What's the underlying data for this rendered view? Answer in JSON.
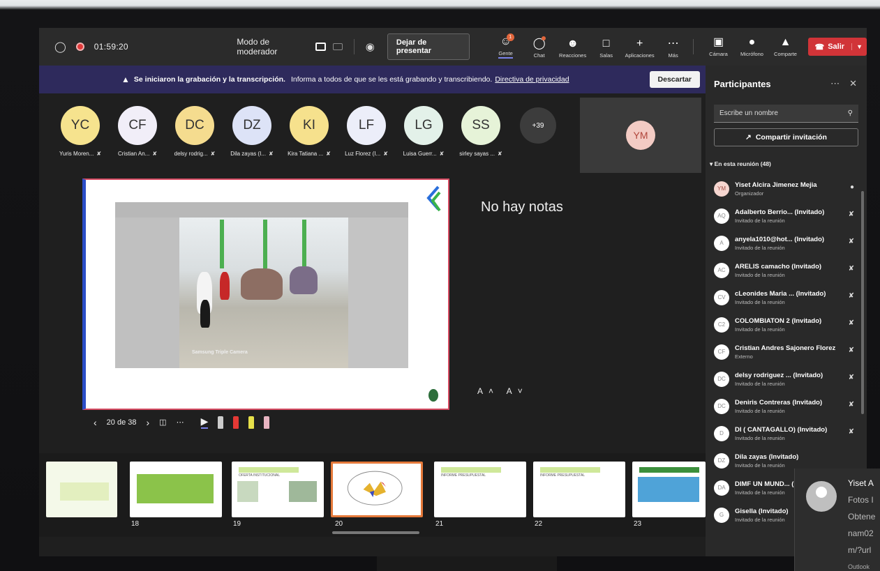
{
  "topbar": {
    "timer": "01:59:20",
    "moderator_label": "Modo de moderador",
    "stop_presenting": "Dejar de presentar",
    "items": [
      {
        "label": "Gente",
        "icon": "people-icon",
        "badge": "1"
      },
      {
        "label": "Chat",
        "icon": "chat-icon"
      },
      {
        "label": "Reacciones",
        "icon": "reactions-icon"
      },
      {
        "label": "Salas",
        "icon": "rooms-icon"
      },
      {
        "label": "Aplicaciones",
        "icon": "plus-icon"
      },
      {
        "label": "Más",
        "icon": "more-icon"
      }
    ],
    "controls": [
      {
        "label": "Cámara",
        "icon": "camera-off-icon"
      },
      {
        "label": "Micrófono",
        "icon": "mic-icon"
      },
      {
        "label": "Comparte",
        "icon": "share-icon"
      }
    ],
    "leave": "Salir"
  },
  "banner": {
    "bold": "Se iniciaron la grabación y la transcripción.",
    "text": "Informa a todos de que se les está grabando y transcribiendo.",
    "link": "Directiva de privacidad",
    "discard": "Descartar"
  },
  "avatars": [
    {
      "initials": "YC",
      "name": "Yuris Moren...",
      "color": "#f6e38e"
    },
    {
      "initials": "CF",
      "name": "Cristian An...",
      "color": "#f1eef8"
    },
    {
      "initials": "DC",
      "name": "delsy rodrig...",
      "color": "#f5dc8f"
    },
    {
      "initials": "DZ",
      "name": "Dila zayas (I...",
      "color": "#dde3f7"
    },
    {
      "initials": "KI",
      "name": "Kira Tatiana ...",
      "color": "#f6e18d"
    },
    {
      "initials": "LF",
      "name": "Luz Florez (I...",
      "color": "#eceef9"
    },
    {
      "initials": "LG",
      "name": "Luisa Guerr...",
      "color": "#e3f1e9"
    },
    {
      "initials": "SS",
      "name": "sirley sayas ...",
      "color": "#e6f3d8"
    }
  ],
  "more_count": "+39",
  "self_tile": {
    "initials": "YM"
  },
  "slide": {
    "camera_label": "Samsung Triple Camera",
    "notes": "No hay notas",
    "font_buttons": "A˄ A˅",
    "counter": "20 de 38"
  },
  "sidebar": {
    "title": "Participantes",
    "search_placeholder": "Escribe un nombre",
    "share_invite": "Compartir invitación",
    "section": "En esta reunión (48)",
    "participants": [
      {
        "initials": "YM",
        "name": "Yiset Alcira Jimenez Mejia",
        "role": "Organizador"
      },
      {
        "initials": "AQ",
        "name": "Adalberto Berrio... (Invitado)",
        "role": "Invitado de la reunión"
      },
      {
        "initials": "A",
        "name": "anyela1010@hot... (Invitado)",
        "role": "Invitado de la reunión"
      },
      {
        "initials": "AC",
        "name": "ARELIS camacho (Invitado)",
        "role": "Invitado de la reunión"
      },
      {
        "initials": "CV",
        "name": "cLeonides Maria ... (Invitado)",
        "role": "Invitado de la reunión"
      },
      {
        "initials": "C2",
        "name": "COLOMBIATON 2 (Invitado)",
        "role": "Invitado de la reunión"
      },
      {
        "initials": "CF",
        "name": "Cristian Andres Sajonero Florez",
        "role": "Externo"
      },
      {
        "initials": "DC",
        "name": "delsy rodriguez ... (Invitado)",
        "role": "Invitado de la reunión"
      },
      {
        "initials": "DC",
        "name": "Deniris Contreras (Invitado)",
        "role": "Invitado de la reunión"
      },
      {
        "initials": "D",
        "name": "DI ( CANTAGALLO) (Invitado)",
        "role": "Invitado de la reunión"
      },
      {
        "initials": "DZ",
        "name": "Dila zayas (Invitado)",
        "role": "Invitado de la reunión"
      },
      {
        "initials": "DA",
        "name": "DIMF UN MUND... (I",
        "role": "Invitado de la reunión"
      },
      {
        "initials": "G",
        "name": "Gisella (Invitado)",
        "role": "Invitado de la reunión"
      }
    ]
  },
  "filmstrip": {
    "numbers": [
      "18",
      "19",
      "20",
      "21",
      "22",
      "23"
    ],
    "titles": [
      "OFERTA INSTITUCIONAL",
      "INFORME PRESUPUESTAL",
      "INFORME PRESUPUESTAL",
      "INFORME PRESUPUESTAL"
    ]
  },
  "toast": {
    "name": "Yiset A",
    "lines": [
      "Fotos I",
      "Obtene",
      "nam02",
      "m/?url"
    ],
    "app": "Outlook"
  }
}
